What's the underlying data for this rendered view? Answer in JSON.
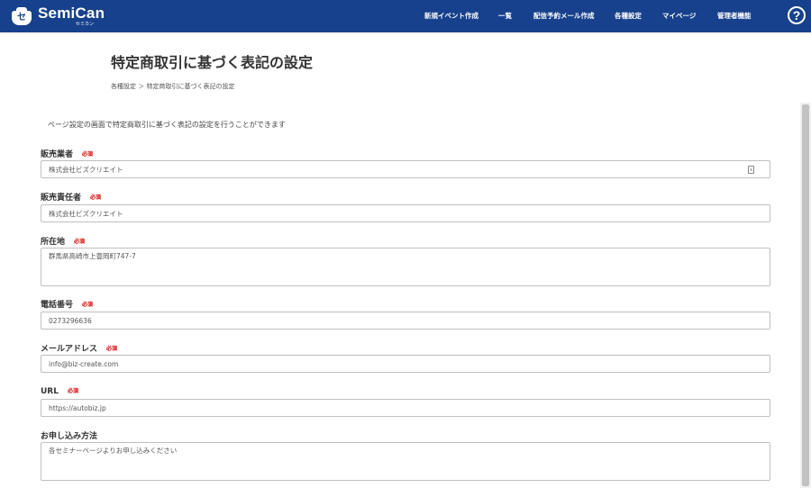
{
  "header": {
    "logo_text": "SemiCan",
    "logo_sub": "セミカン",
    "logo_glyph": "セ",
    "nav": [
      "新規イベント作成",
      "一覧",
      "配信予約メール作成",
      "各種設定",
      "マイページ",
      "管理者機能"
    ],
    "help_label": "?"
  },
  "page": {
    "title": "特定商取引に基づく表記の設定",
    "breadcrumb": "各種設定 ＞ 特定商取引に基づく表記の設定",
    "description": "ページ設定の画面で特定商取引に基づく表記の設定を行うことができます"
  },
  "form": {
    "required_label": "必須",
    "fields": [
      {
        "label": "販売業者",
        "required": true,
        "value": "株式会社ビズクリエイト"
      },
      {
        "label": "販売責任者",
        "required": true,
        "value": "株式会社ビズクリエイト"
      },
      {
        "label": "所在地",
        "required": true,
        "value": "群馬県高崎市上豊岡町747-7"
      },
      {
        "label": "電話番号",
        "required": true,
        "value": "0273296636"
      },
      {
        "label": "メールアドレス",
        "required": true,
        "value": "info@biz-create.com"
      },
      {
        "label": "URL",
        "required": true,
        "value": "https://autobiz.jp"
      },
      {
        "label": "お申し込み方法",
        "required": false,
        "value": "各セミナーページよりお申し込みください"
      }
    ]
  }
}
